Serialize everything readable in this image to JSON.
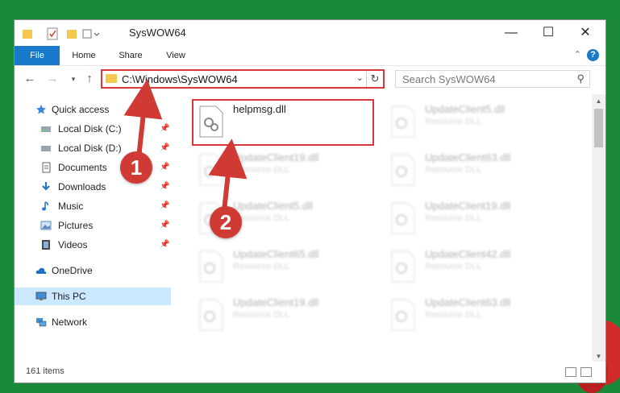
{
  "window": {
    "title": "SysWOW64",
    "controls": {
      "minimize": "—",
      "maximize": "☐",
      "close": "✕"
    }
  },
  "ribbon": {
    "tabs": [
      "File",
      "Home",
      "Share",
      "View"
    ],
    "help": "?"
  },
  "address": {
    "path": "C:\\Windows\\SysWOW64",
    "search_placeholder": "Search SysWOW64"
  },
  "navigation": {
    "items": [
      {
        "label": "Quick access",
        "icon": "star-icon"
      },
      {
        "label": "Local Disk (C:)",
        "icon": "drive-icon",
        "pinned": true
      },
      {
        "label": "Local Disk (D:)",
        "icon": "drive-icon",
        "pinned": true
      },
      {
        "label": "Documents",
        "icon": "documents-icon",
        "pinned": true
      },
      {
        "label": "Downloads",
        "icon": "downloads-icon",
        "pinned": true
      },
      {
        "label": "Music",
        "icon": "music-icon",
        "pinned": true
      },
      {
        "label": "Pictures",
        "icon": "pictures-icon",
        "pinned": true
      },
      {
        "label": "Videos",
        "icon": "videos-icon",
        "pinned": true
      },
      {
        "label": "OneDrive",
        "icon": "cloud-icon"
      },
      {
        "label": "This PC",
        "icon": "computer-icon",
        "selected": true
      },
      {
        "label": "Network",
        "icon": "network-icon"
      }
    ]
  },
  "files": [
    {
      "name": "helpmsg.dll",
      "type": "",
      "highlighted": true
    },
    {
      "name": "UpdateClient5.dll",
      "type": "Resource DLL"
    },
    {
      "name": "UpdateClient19.dll",
      "type": "Resource DLL"
    },
    {
      "name": "UpdateClient63.dll",
      "type": "Resource DLL"
    },
    {
      "name": "UpdateClient5.dll",
      "type": "Resource DLL"
    },
    {
      "name": "UpdateClient19.dll",
      "type": "Resource DLL"
    },
    {
      "name": "UpdateClient65.dll",
      "type": "Resource DLL"
    },
    {
      "name": "UpdateClient42.dll",
      "type": "Resource DLL"
    },
    {
      "name": "UpdateClient19.dll",
      "type": "Resource DLL"
    },
    {
      "name": "UpdateClient63.dll",
      "type": "Resource DLL"
    }
  ],
  "status": {
    "item_count": "161 items"
  },
  "annotations": {
    "step1": "1",
    "step2": "2",
    "color": "#cf3b34"
  }
}
